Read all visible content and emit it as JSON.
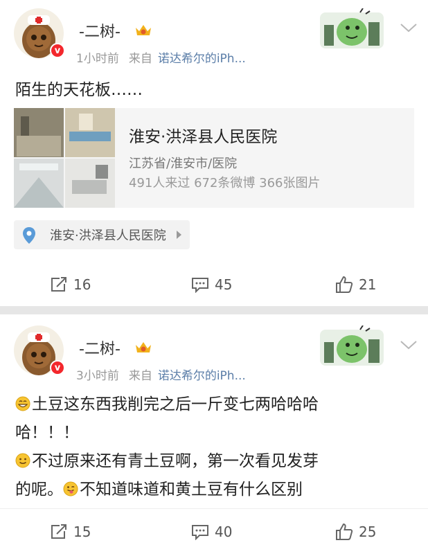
{
  "posts": [
    {
      "username": "-二树-",
      "verified_mark": "v",
      "time": "1小时前",
      "source_label": "来自",
      "source": "诺达希尔的iPh...",
      "text_lines": [
        "陌生的天花板……"
      ],
      "place_card": {
        "title": "淮安·洪泽县人民医院",
        "region": "江苏省/淮安市/医院",
        "stats": "491人来过 672条微博 366张图片"
      },
      "location_tag": "淮安·洪泽县人民医院",
      "actions": {
        "reposts": "16",
        "comments": "45",
        "likes": "21"
      }
    },
    {
      "username": "-二树-",
      "verified_mark": "v",
      "time": "3小时前",
      "source_label": "来自",
      "source": "诺达希尔的iPh...",
      "text_lines": [
        "土豆这东西我削完之后一斤变七两哈哈哈",
        "哈！！！",
        "不过原来还有青土豆啊，第一次看见发芽",
        "的呢。",
        "不知道味道和黄土豆有什么区别"
      ],
      "actions": {
        "reposts": "15",
        "comments": "40",
        "likes": "25"
      }
    }
  ],
  "colors": {
    "accent_link": "#5b7ea8",
    "verified_red": "#f3272c",
    "meta_gray": "#999999"
  },
  "icons": [
    "verified-badge-icon",
    "crown-level-icon",
    "dinosaur-card-badge-icon",
    "chevron-down-icon",
    "location-pin-icon",
    "repost-icon",
    "comment-icon",
    "like-icon",
    "grin-emoji-icon",
    "smile-emoji-icon",
    "tongue-emoji-icon"
  ]
}
